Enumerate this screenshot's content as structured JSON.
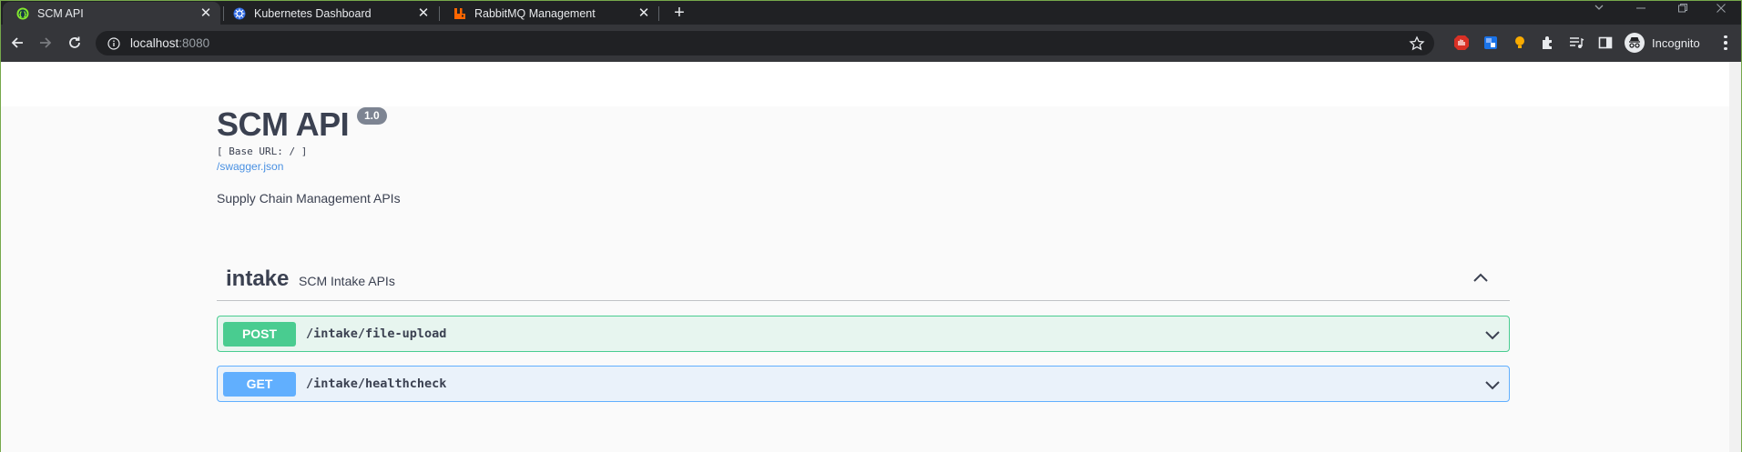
{
  "browser": {
    "tabs": [
      {
        "title": "SCM API",
        "active": true,
        "favicon": "swagger-icon"
      },
      {
        "title": "Kubernetes Dashboard",
        "active": false,
        "favicon": "kubernetes-icon"
      },
      {
        "title": "RabbitMQ Management",
        "active": false,
        "favicon": "rabbitmq-icon"
      }
    ],
    "address": {
      "host": "localhost",
      "port": ":8080"
    },
    "profile_label": "Incognito",
    "accent_color": "#76a84b"
  },
  "api": {
    "title": "SCM API",
    "version": "1.0",
    "base_url": "[ Base URL: / ]",
    "spec_link": "/swagger.json",
    "description": "Supply Chain Management APIs"
  },
  "tag": {
    "name": "intake",
    "description": "SCM Intake APIs",
    "expanded": true
  },
  "operations": [
    {
      "method": "POST",
      "path": "/intake/file-upload",
      "color": "#49cc90"
    },
    {
      "method": "GET",
      "path": "/intake/healthcheck",
      "color": "#61affe"
    }
  ]
}
